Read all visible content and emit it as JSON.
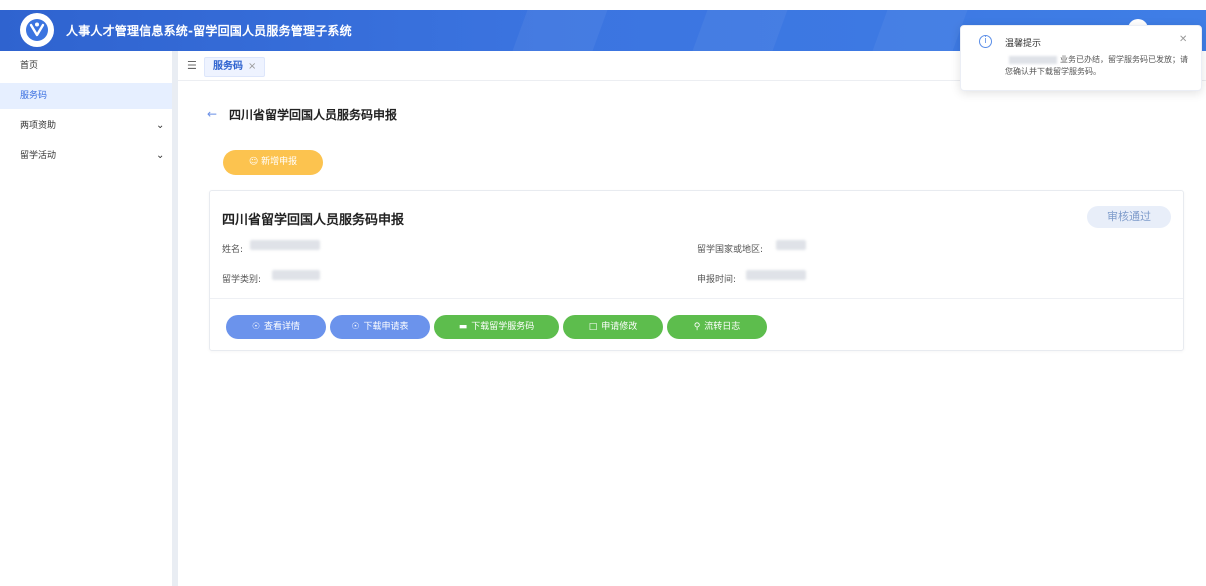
{
  "header": {
    "title": "人事人才管理信息系统-留学回国人员服务管理子系统"
  },
  "sidebar": {
    "items": [
      {
        "label": "首页",
        "active": false,
        "expandable": false
      },
      {
        "label": "服务码",
        "active": true,
        "expandable": false
      },
      {
        "label": "两项资助",
        "active": false,
        "expandable": true
      },
      {
        "label": "留学活动",
        "active": false,
        "expandable": true
      }
    ]
  },
  "tabs": {
    "active_label": "服务码",
    "close_glyph": "×"
  },
  "content": {
    "page_title": "四川省留学回国人员服务码申报",
    "new_button": "新增申报",
    "card": {
      "title": "四川省留学回国人员服务码申报",
      "status": "审核通过",
      "fields": {
        "name_label": "姓名:",
        "country_label": "留学国家或地区:",
        "type_label": "留学类别:",
        "time_label": "申报时间:"
      },
      "actions": [
        {
          "label": "查看详情",
          "icon": "eye-icon",
          "color": "#6b93ec"
        },
        {
          "label": "下载申请表",
          "icon": "eye-icon",
          "color": "#6b93ec"
        },
        {
          "label": "下载留学服务码",
          "icon": "folder-icon",
          "color": "#5dbd4d"
        },
        {
          "label": "申请修改",
          "icon": "document-icon",
          "color": "#5dbd4d"
        },
        {
          "label": "流转日志",
          "icon": "search-icon",
          "color": "#5dbd4d"
        }
      ]
    }
  },
  "notification": {
    "title": "温馨提示",
    "message": "业务已办结，留学服务码已发放；请您确认并下载留学服务码。"
  },
  "colors": {
    "header": "#3b74e0",
    "accent_blue": "#6b93ec",
    "accent_green": "#5dbd4d",
    "accent_yellow": "#fcc34f"
  }
}
